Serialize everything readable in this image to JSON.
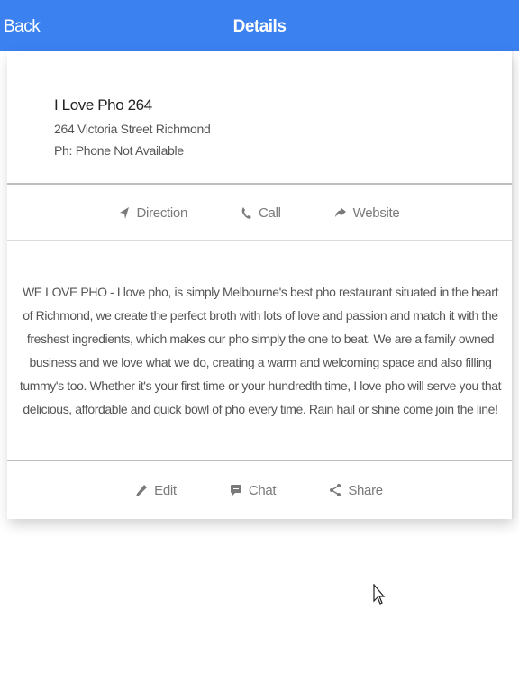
{
  "nav": {
    "back_label": "Back",
    "title": "Details"
  },
  "place": {
    "name": "I Love Pho 264",
    "address": "264 Victoria Street Richmond",
    "phone": "Ph: Phone Not Available"
  },
  "actions_top": [
    {
      "label": "Direction",
      "icon": "location-arrow-icon"
    },
    {
      "label": "Call",
      "icon": "phone-icon"
    },
    {
      "label": "Website",
      "icon": "share-arrow-icon"
    }
  ],
  "description": "WE LOVE PHO -  I love pho, is simply Melbourne's best pho restaurant situated in the heart of Richmond, we create the perfect broth with lots of love and passion and match it with the freshest ingredients, which makes our pho simply the one to beat. We are a family owned business and we love what we do, creating a warm and welcoming space and also filling tummy's too.  Whether it's your first time or your hundredth time, I love pho will serve you that delicious, affordable and quick bowl of pho every time.  Rain hail or shine come join the line!",
  "actions_bottom": [
    {
      "label": "Edit",
      "icon": "pencil-icon"
    },
    {
      "label": "Chat",
      "icon": "chat-bubble-icon"
    },
    {
      "label": "Share",
      "icon": "share-icon"
    }
  ],
  "colors": {
    "nav_bar": "#3b82f0",
    "action_text": "#7a7a7a"
  }
}
